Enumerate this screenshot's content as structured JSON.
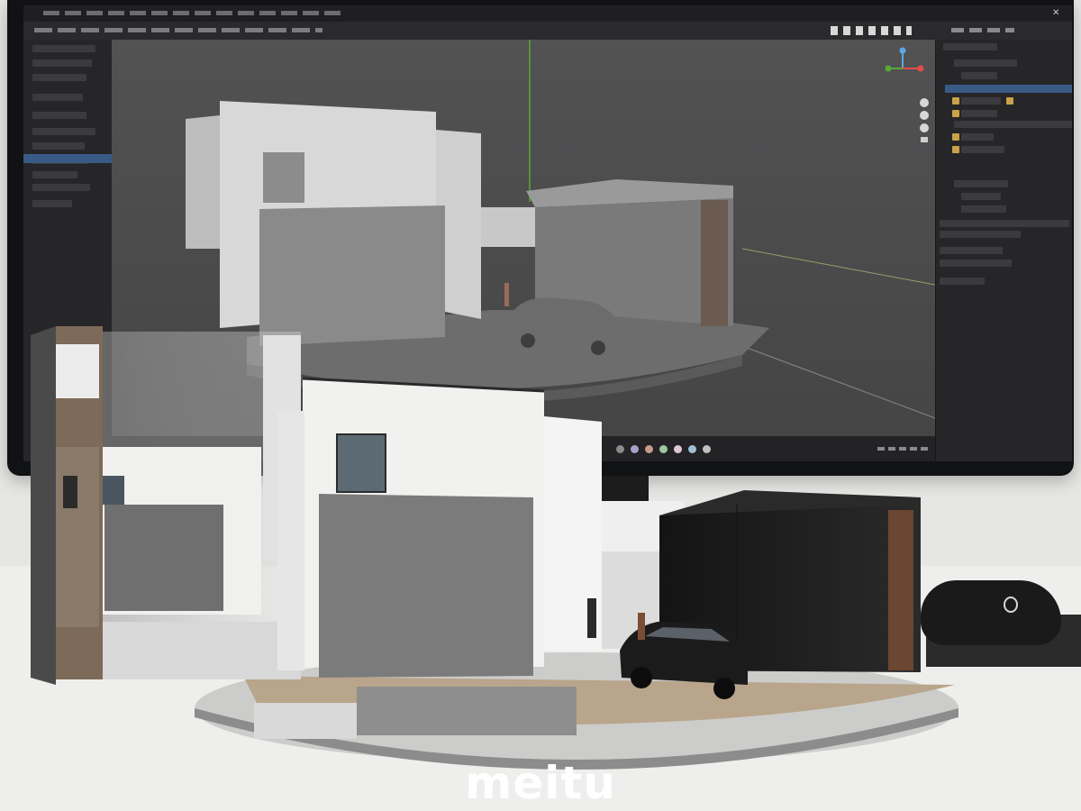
{
  "watermark": {
    "text": "meitu"
  },
  "colors": {
    "monitor_bezel": "#111214",
    "viewport": "#4a4a4b",
    "panel": "#262628",
    "selection": "#3a5a86",
    "wall_white": "#f1f1f0",
    "wall_gray": "#7b7b7b",
    "garage_dark": "#1f1f1f",
    "wood": "#6b4631",
    "ground": "#b9a58b"
  },
  "icons": {
    "axis_gizmo": "axis-gizmo-icon",
    "mouse": "computer-mouse"
  }
}
